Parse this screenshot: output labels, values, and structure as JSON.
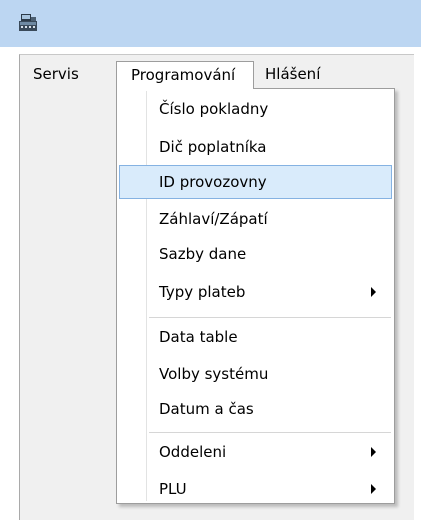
{
  "window": {
    "app_icon": "cash-register-icon",
    "title_bar_color": "#bcd6f2"
  },
  "menubar": {
    "items": [
      {
        "label": "Servis"
      },
      {
        "label": "Programování",
        "open": true
      },
      {
        "label": "Hlášení"
      }
    ]
  },
  "dropdown": {
    "items": [
      {
        "label": "Číslo pokladny"
      },
      {
        "label": "Dič poplatníka"
      },
      {
        "label": "ID provozovny",
        "highlighted": true
      },
      {
        "label": "Záhlaví/Zápatí"
      },
      {
        "label": "Sazby dane"
      },
      {
        "label": "Typy plateb",
        "submenu": true
      },
      {
        "label": "Data table"
      },
      {
        "label": "Volby systému"
      },
      {
        "label": "Datum a čas"
      },
      {
        "label": "Oddeleni",
        "submenu": true
      },
      {
        "label": "PLU",
        "submenu": true
      }
    ],
    "highlight_bg": "#d9ebfb",
    "highlight_border": "#85b2e2"
  }
}
